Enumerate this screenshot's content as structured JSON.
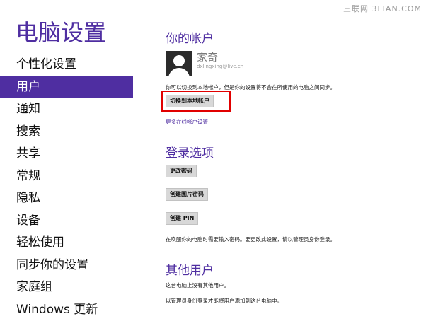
{
  "watermark": "三联网 3LIAN.COM",
  "app_title": "电脑设置",
  "nav": {
    "items": [
      {
        "label": "个性化设置"
      },
      {
        "label": "用户"
      },
      {
        "label": "通知"
      },
      {
        "label": "搜索"
      },
      {
        "label": "共享"
      },
      {
        "label": "常规"
      },
      {
        "label": "隐私"
      },
      {
        "label": "设备"
      },
      {
        "label": "轻松使用"
      },
      {
        "label": "同步你的设置"
      },
      {
        "label": "家庭组"
      },
      {
        "label": "Windows 更新"
      }
    ],
    "active_index": 1
  },
  "account": {
    "heading": "你的帐户",
    "user_name": "家奇",
    "user_email": "dxlingxing@live.cn",
    "description": "你可以切换到本地帐户，但是你的设置将不会在所使用的电脑之间同步。",
    "switch_button": "切换到本地帐户",
    "more_link": "更多在线帐户设置"
  },
  "login": {
    "heading": "登录选项",
    "change_password": "更改密码",
    "create_picture_password": "创建图片密码",
    "create_pin": "创建 PIN",
    "note": "在唤醒你的电脑时需要输入密码。要更改此设置，请以管理员身份登录。"
  },
  "others": {
    "heading": "其他用户",
    "none_text": "这台电脑上没有其他用户。",
    "admin_note": "以管理员身份登录才能将用户添加到这台电脑中。"
  },
  "colors": {
    "accent": "#4f2ea1",
    "highlight_border": "#e10000"
  }
}
